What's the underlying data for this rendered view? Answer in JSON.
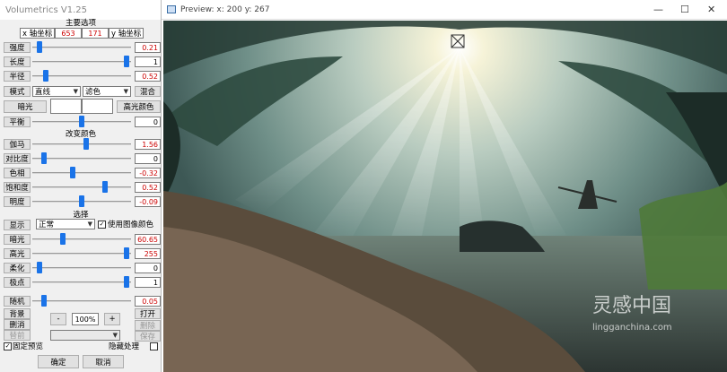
{
  "panel": {
    "title": "Volumetrics V1.25",
    "main_section": "主要选项",
    "x_label": "x 轴坐标",
    "x_value": "653",
    "y_value": "171",
    "y_label": "y 轴坐标",
    "sliders_top": [
      {
        "label": "强度",
        "value": "0.21",
        "pos": 0.05
      },
      {
        "label": "长度",
        "value": "1",
        "pos": 0.98
      },
      {
        "label": "半径",
        "value": "0.52",
        "pos": 0.12
      }
    ],
    "mode_label": "模式",
    "mode_value": "直线",
    "filter_value": "滤色",
    "blend_label": "混合",
    "dark_label": "暗光",
    "highlight_color_label": "高光颜色",
    "balance_label": "平衡",
    "balance_value": "0",
    "balance_pos": 0.5,
    "change_color_section": "改变颜色",
    "sliders_color": [
      {
        "label": "伽马",
        "value": "1.56",
        "pos": 0.55
      },
      {
        "label": "对比度",
        "value": "0",
        "pos": 0.1
      },
      {
        "label": "色相",
        "value": "-0.32",
        "pos": 0.4
      },
      {
        "label": "饱和度",
        "value": "0.52",
        "pos": 0.75
      },
      {
        "label": "明度",
        "value": "-0.09",
        "pos": 0.5
      }
    ],
    "select_section": "选择",
    "display_label": "显示",
    "display_value": "正常",
    "use_image_color": "使用图像颜色",
    "use_image_color_checked": true,
    "sliders_select": [
      {
        "label": "暗光",
        "value": "60.65",
        "pos": 0.3
      },
      {
        "label": "高光",
        "value": "255",
        "pos": 0.98
      },
      {
        "label": "柔化",
        "value": "0",
        "pos": 0.05
      },
      {
        "label": "极点",
        "value": "1",
        "pos": 0.98
      }
    ],
    "random_label": "随机",
    "random_value": "0.05",
    "random_pos": 0.1,
    "bg_label": "背景",
    "minus": "-",
    "zoom": "100%",
    "plus": "+",
    "open_label": "打开",
    "delete_label": "删消",
    "delete2_label": "删除",
    "prev_label": "替前",
    "save_label": "保存",
    "fixed_preview": "固定预览",
    "fixed_preview_checked": true,
    "hide_process": "隐藏处理",
    "ok": "确定",
    "cancel": "取消"
  },
  "preview": {
    "title": "Preview:  x: 200 y: 267",
    "minimize": "—",
    "maximize": "☐",
    "close": "✕",
    "watermark_cn": "灵感中国",
    "watermark_url": "lingganchina.com"
  },
  "colors": {
    "accent": "#1a73e8",
    "value_red": "#cc0000"
  }
}
